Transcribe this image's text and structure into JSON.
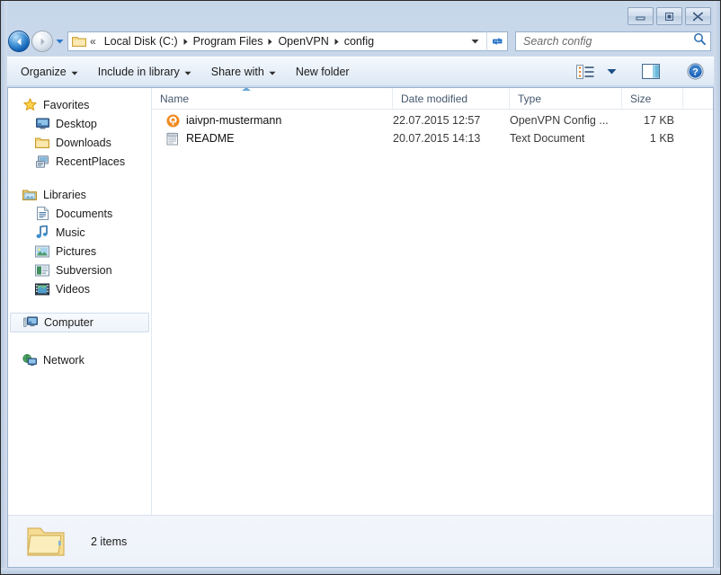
{
  "window": {
    "title": "config",
    "controls": [
      {
        "name": "minimize-button",
        "label": "Minimize"
      },
      {
        "name": "maximize-button",
        "label": "Maximize"
      },
      {
        "name": "close-button",
        "label": "Close"
      }
    ]
  },
  "navigation": {
    "back_label": "Back",
    "forward_label": "Forward",
    "recent_pages_label": "Recent pages",
    "refresh_label": "Refresh",
    "chevrons": "«",
    "breadcrumbs": [
      {
        "label": "Local Disk (C:)"
      },
      {
        "label": "Program Files"
      },
      {
        "label": "OpenVPN"
      },
      {
        "label": "config"
      }
    ]
  },
  "search": {
    "placeholder": "Search config",
    "value": "",
    "icon": "search-icon"
  },
  "toolbar": {
    "items": [
      {
        "label": "Organize",
        "has_caret": true,
        "name": "organize"
      },
      {
        "label": "Include in library",
        "has_caret": true,
        "name": "include-in-library"
      },
      {
        "label": "Share with",
        "has_caret": true,
        "name": "share-with"
      },
      {
        "label": "New folder",
        "has_caret": false,
        "name": "new-folder"
      }
    ],
    "view_icon": "view-layout-icon",
    "view_caret_icon": "chevron-down-icon",
    "preview_pane_icon": "preview-pane-icon",
    "help_icon": "help-icon"
  },
  "sidebar": {
    "groups": [
      {
        "header": {
          "label": "Favorites",
          "icon": "star-icon",
          "name": "sidebar-group-favorites"
        },
        "items": [
          {
            "label": "Desktop",
            "icon": "desktop-icon",
            "name": "sidebar-item-desktop"
          },
          {
            "label": "Downloads",
            "icon": "folder-icon",
            "name": "sidebar-item-downloads"
          },
          {
            "label": "RecentPlaces",
            "icon": "recent-places-icon",
            "name": "sidebar-item-recentplaces"
          }
        ]
      },
      {
        "header": {
          "label": "Libraries",
          "icon": "libraries-icon",
          "name": "sidebar-group-libraries"
        },
        "items": [
          {
            "label": "Documents",
            "icon": "documents-icon",
            "name": "sidebar-item-documents"
          },
          {
            "label": "Music",
            "icon": "music-icon",
            "name": "sidebar-item-music"
          },
          {
            "label": "Pictures",
            "icon": "pictures-icon",
            "name": "sidebar-item-pictures"
          },
          {
            "label": "Subversion",
            "icon": "subversion-icon",
            "name": "sidebar-item-subversion"
          },
          {
            "label": "Videos",
            "icon": "videos-icon",
            "name": "sidebar-item-videos"
          }
        ]
      },
      {
        "header": {
          "label": "Computer",
          "icon": "computer-icon",
          "name": "sidebar-item-computer",
          "selected": true
        },
        "items": []
      },
      {
        "header": {
          "label": "Network",
          "icon": "network-icon",
          "name": "sidebar-item-network"
        },
        "items": []
      }
    ]
  },
  "filelist": {
    "columns": [
      {
        "key": "name",
        "label": "Name",
        "sorted": true
      },
      {
        "key": "date",
        "label": "Date modified"
      },
      {
        "key": "type",
        "label": "Type"
      },
      {
        "key": "size",
        "label": "Size"
      }
    ],
    "rows": [
      {
        "name": "iaivpn-mustermann",
        "date": "22.07.2015 12:57",
        "type": "OpenVPN Config ...",
        "size": "17 KB",
        "icon": "openvpn-config-icon"
      },
      {
        "name": "README",
        "date": "20.07.2015 14:13",
        "type": "Text Document",
        "size": "1 KB",
        "icon": "text-document-icon"
      }
    ]
  },
  "statusbar": {
    "icon": "folder-large-icon",
    "text": "2 items"
  },
  "colors": {
    "accent": "#1466b8",
    "openvpn_orange": "#f08a1e",
    "frame": "#c7d7ea",
    "column_header_text": "#45576d"
  }
}
